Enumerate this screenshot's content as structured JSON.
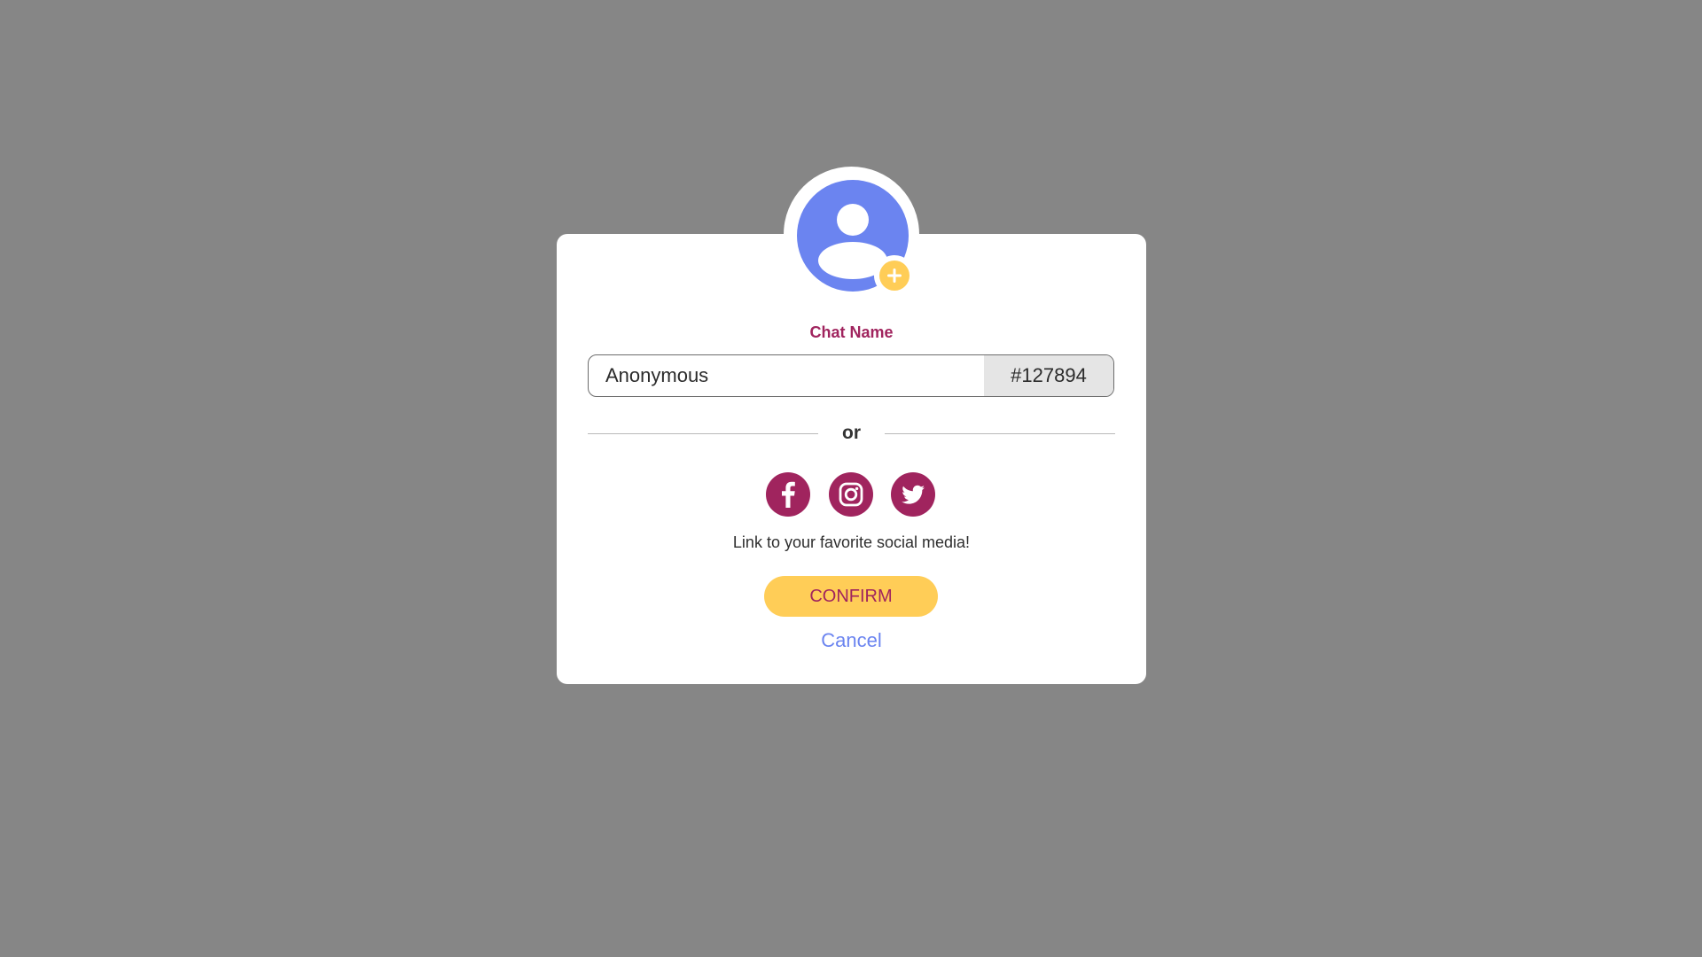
{
  "dialog": {
    "chat_name_label": "Chat Name",
    "name_input": {
      "value": "Anonymous",
      "placeholder": ""
    },
    "name_tag": "#127894",
    "or_label": "or",
    "social": {
      "icons": [
        "facebook-icon",
        "instagram-icon",
        "twitter-icon"
      ],
      "caption": "Link to your favorite social media!"
    },
    "confirm_label": "CONFIRM",
    "cancel_label": "Cancel"
  },
  "colors": {
    "overlay": "#868686",
    "accent_purple": "#a0245e",
    "accent_yellow": "#ffcd57",
    "accent_blue": "#6b84f0"
  }
}
